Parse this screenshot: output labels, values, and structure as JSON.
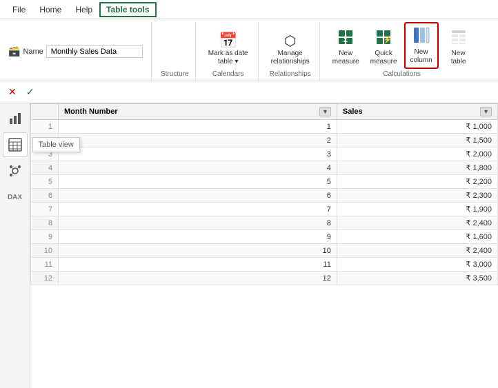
{
  "menubar": {
    "items": [
      "File",
      "Home",
      "Help",
      "Table tools"
    ],
    "active": "Table tools"
  },
  "ribbon": {
    "name_label": "Name",
    "name_value": "Monthly Sales Data",
    "groups": {
      "structure": {
        "label": "Structure"
      },
      "calendars": {
        "label": "Calendars",
        "buttons": [
          {
            "id": "mark-date-table",
            "icon": "📅",
            "label": "Mark as date\ntable ▾"
          }
        ]
      },
      "relationships": {
        "label": "Relationships",
        "buttons": [
          {
            "id": "manage-relationships",
            "icon": "🔗",
            "label": "Manage\nrelationships"
          }
        ]
      },
      "calculations": {
        "label": "Calculations",
        "buttons": [
          {
            "id": "new-measure",
            "icon": "📊",
            "label": "New\nmeasure"
          },
          {
            "id": "quick-measure",
            "icon": "⚡",
            "label": "Quick\nmeasure"
          },
          {
            "id": "new-column",
            "icon": "📋",
            "label": "New\ncolumn",
            "highlighted": true
          },
          {
            "id": "new-table",
            "icon": "📄",
            "label": "New\ntable"
          }
        ]
      }
    }
  },
  "formula_bar": {
    "cancel": "✕",
    "confirm": "✓"
  },
  "sidebar": {
    "icons": [
      {
        "id": "report",
        "symbol": "📊",
        "label": "Report view"
      },
      {
        "id": "table",
        "symbol": "⊞",
        "label": "Table view",
        "active": true,
        "tooltip": "Table view"
      },
      {
        "id": "model",
        "symbol": "◈",
        "label": "Model view"
      },
      {
        "id": "dax",
        "symbol": "DAX",
        "label": "DAX query view"
      }
    ]
  },
  "table": {
    "columns": [
      "Month Number",
      "Sales"
    ],
    "rows": [
      {
        "num": 1,
        "sales": "₹ 1,000"
      },
      {
        "num": 2,
        "sales": "₹ 1,500"
      },
      {
        "num": 3,
        "sales": "₹ 2,000"
      },
      {
        "num": 4,
        "sales": "₹ 1,800"
      },
      {
        "num": 5,
        "sales": "₹ 2,200"
      },
      {
        "num": 6,
        "sales": "₹ 2,300"
      },
      {
        "num": 7,
        "sales": "₹ 1,900"
      },
      {
        "num": 8,
        "sales": "₹ 2,400"
      },
      {
        "num": 9,
        "sales": "₹ 1,600"
      },
      {
        "num": 10,
        "sales": "₹ 2,400"
      },
      {
        "num": 11,
        "sales": "₹ 3,000"
      },
      {
        "num": 12,
        "sales": "₹ 3,500"
      }
    ]
  }
}
